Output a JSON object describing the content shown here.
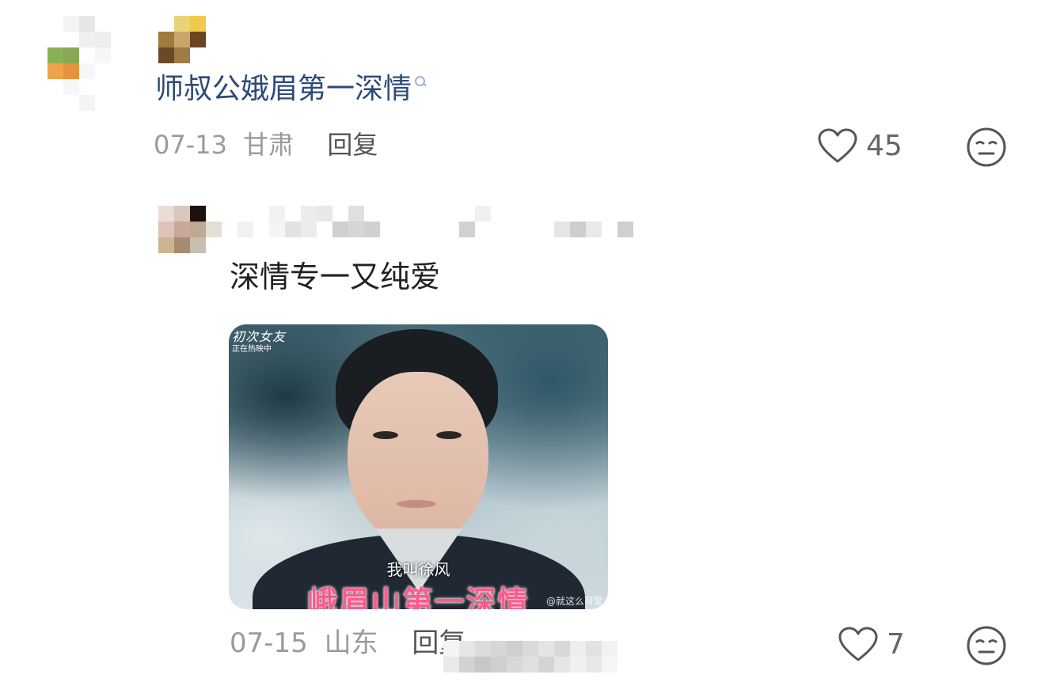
{
  "top_comment": {
    "username": "师叔公娥眉第一深情",
    "date": "07-13",
    "location": "甘肃",
    "reply_label": "回复",
    "like_count": "45",
    "avatar_mosaic": [
      "#ffffff",
      "#f3f3f3",
      "#e6e6e6",
      "#ffffff",
      "#ffffff",
      "#ffffff",
      "#ffffff",
      "#f0f0f0",
      "#eeeeee",
      "#ffffff",
      "#8bb156",
      "#8aa754",
      "#ffffff",
      "#f6f6f6",
      "#ffffff",
      "#f2a24a",
      "#e8913d",
      "#f7f7f7",
      "#ffffff",
      "#ffffff",
      "#ffffff",
      "#f7f7f7",
      "#ffffff",
      "#ffffff",
      "#ffffff",
      "#ffffff",
      "#ffffff",
      "#f4f4f4",
      "#ffffff",
      "#ffffff"
    ],
    "badge_mosaic": [
      "#ffffff",
      "#e9d27a",
      "#f0ca4c",
      "#a07b3e",
      "#caa56a",
      "#6b4420",
      "#6a4a26",
      "#9f7b47",
      "#ffffff"
    ]
  },
  "reply_comment": {
    "text": "深情专一又纯爱",
    "date": "07-15",
    "location": "山东",
    "reply_label": "回复",
    "like_count": "7",
    "image": {
      "top_logo": "初次女友",
      "top_sub": "正在热映中",
      "subtitle_line1": "我叫徐风",
      "subtitle_line2": "峨眉山第一深情",
      "watermark": "@就这么可爱"
    },
    "avatar_mosaic": [
      "#e9dcd7",
      "#d9c6be",
      "#1c120d",
      "#ffffff",
      "#dbc3b8",
      "#c8a89a",
      "#bfa894",
      "#e4dfd2",
      "#cdb591",
      "#a88a6e",
      "#c9bdb0",
      "#ffffff"
    ],
    "name_mosaic_row1": [
      "#ffffff",
      "#ffffff",
      "#f2f2f2",
      "#ffffff",
      "#ececec",
      "#e8e8e8",
      "#ffffff",
      "#e0e0e0",
      "#ffffff",
      "#ffffff",
      "#ffffff",
      "#ffffff",
      "#ffffff",
      "#ffffff",
      "#ffffff",
      "#f0f0f0",
      "#ffffff",
      "#ffffff",
      "#ffffff",
      "#ffffff",
      "#ffffff",
      "#ffffff",
      "#ffffff",
      "#ffffff",
      "#ffffff"
    ],
    "name_mosaic_row2": [
      "#f1f1f1",
      "#ffffff",
      "#f4f4f4",
      "#e2e2e2",
      "#ebebeb",
      "#ffffff",
      "#cfcfcf",
      "#d6d6d6",
      "#d0d0d0",
      "#ffffff",
      "#ffffff",
      "#ffffff",
      "#ffffff",
      "#ffffff",
      "#d1d1d1",
      "#ffffff",
      "#ffffff",
      "#ffffff",
      "#ffffff",
      "#ffffff",
      "#e5e5e5",
      "#cdcdcd",
      "#e9e9e9",
      "#ffffff",
      "#cfcfcf"
    ],
    "overlay_mosaic": [
      "#f4f4f4",
      "#e6e6e6",
      "#dcdcdc",
      "#d6d6d6",
      "#cfcfcf",
      "#dadada",
      "#e4e4e4",
      "#d8d8d8",
      "#eeeeee",
      "#e2e2e2",
      "#f2f2f2",
      "#ffffff",
      "#e9e9e9",
      "#d2d2d2",
      "#c7c7c7",
      "#cfcfcf",
      "#d8d8d8",
      "#e0e0e0",
      "#d4d4d4",
      "#e6e6e6",
      "#f0f0f0",
      "#e8e8e8",
      "#f6f6f6",
      "#ffffff"
    ]
  },
  "icons": {
    "like": "heart-outline-icon",
    "emoji": "neutral-face-icon",
    "search": "search-icon"
  },
  "colors": {
    "username": "#2c4a7a",
    "meta": "#9a9a9a",
    "reply_label": "#555555",
    "caption_pink": "#ff5a8c"
  }
}
